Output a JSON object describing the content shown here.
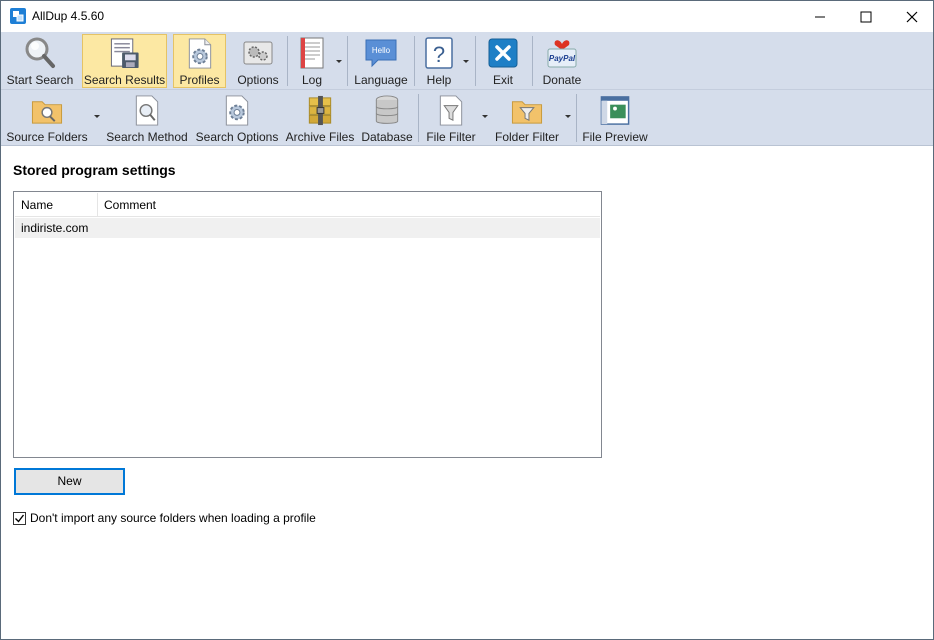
{
  "window": {
    "title": "AllDup 4.5.60"
  },
  "toolbar_main": {
    "items": [
      {
        "label": "Start Search",
        "icon": "magnifier-icon"
      },
      {
        "label": "Search Results",
        "icon": "search-results-icon",
        "active": true
      },
      {
        "label": "Profiles",
        "icon": "profiles-gear-icon",
        "active": true
      },
      {
        "label": "Options",
        "icon": "options-gears-icon"
      },
      {
        "label": "Log",
        "icon": "log-document-icon",
        "has_dropdown": true
      },
      {
        "label": "Language",
        "icon": "language-hello-icon",
        "bubble_text": "Hello"
      },
      {
        "label": "Help",
        "icon": "help-question-icon",
        "has_dropdown": true
      },
      {
        "label": "Exit",
        "icon": "exit-x-icon"
      },
      {
        "label": "Donate",
        "icon": "paypal-donate-icon",
        "badge_text": "PayPal"
      }
    ]
  },
  "toolbar_secondary": {
    "items": [
      {
        "label": "Source Folders",
        "icon": "source-folder-icon",
        "has_dropdown": true
      },
      {
        "label": "Search Method",
        "icon": "search-method-icon"
      },
      {
        "label": "Search Options",
        "icon": "search-options-icon"
      },
      {
        "label": "Archive Files",
        "icon": "archive-zip-icon"
      },
      {
        "label": "Database",
        "icon": "database-icon"
      },
      {
        "label": "File Filter",
        "icon": "file-filter-icon",
        "has_dropdown": true
      },
      {
        "label": "Folder Filter",
        "icon": "folder-filter-icon",
        "has_dropdown": true
      },
      {
        "label": "File Preview",
        "icon": "file-preview-icon"
      }
    ]
  },
  "profiles": {
    "section_title": "Stored program settings",
    "columns": [
      "Name",
      "Comment"
    ],
    "rows": [
      {
        "name": "indiriste.com",
        "comment": ""
      }
    ],
    "new_button_label": "New",
    "checkbox": {
      "label": "Don't import any source folders when loading a profile",
      "checked": true
    }
  },
  "colors": {
    "toolbar_bg": "#d5ddeb",
    "active_bg": "#fce8a3",
    "focus_border": "#0078d7",
    "selected_row": "#f0f0f0"
  }
}
